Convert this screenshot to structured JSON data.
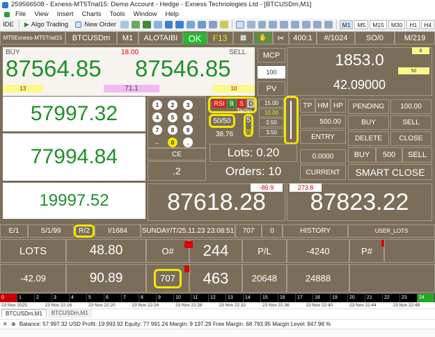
{
  "window": {
    "title": "259566508 - Exness-MT5Trial15: Demo Account - Hedge - Exness Technologies Ltd - [BTCUSDm,M1]"
  },
  "menu": [
    "File",
    "View",
    "Insert",
    "Charts",
    "Tools",
    "Window",
    "Help"
  ],
  "toolbar": {
    "ide": "IDE",
    "algo": "Algo Trading",
    "new_order": "New Order",
    "timeframes": [
      "M1",
      "M5",
      "M15",
      "M30",
      "H1",
      "H4"
    ]
  },
  "panel": {
    "top": {
      "server": "MT5Exness-MT5Trial15",
      "symbol": "BTCUSDm",
      "tf": "M1",
      "user": "ALOTAIBI",
      "ok": "OK",
      "f13": "F13",
      "leverage": "400:1",
      "count": "#/1024",
      "so": "SO/0",
      "m": "M/219"
    },
    "price": {
      "buy_label": "BUY",
      "sell_label": "SELL",
      "spread_top": "18.00",
      "bid": "87564.85",
      "ask": "87546.85",
      "lv": "13",
      "pct": "71.1",
      "rv": "10"
    },
    "mcp": {
      "label": "MCP",
      "value": "1853.0",
      "box_val": "100",
      "tag8": "8",
      "tag50": "50",
      "pv": "PV",
      "pv_value": "42.09000"
    },
    "balances": [
      "57997.32",
      "77994.84",
      "19997.52"
    ],
    "keypad": {
      "keys": [
        "1",
        "2",
        "3",
        "4",
        "5",
        "6",
        "7",
        "8",
        "9",
        "←",
        "0",
        "."
      ],
      "ce": "CE",
      "val": ".2"
    },
    "rsi": {
      "rsi": "RSI",
      "b": "B",
      "s": "S",
      "d": "D",
      "techn": "Techn",
      "fifty": "50/50",
      "five": "5",
      "v": "38.76",
      "twentyfive": "25"
    },
    "levels": [
      "15.00",
      "10.00",
      "2.50",
      "3.50"
    ],
    "tp": {
      "tp": "TP",
      "hm": "HM",
      "hp": "HP",
      "amount": "500.00",
      "entry": "ENTRY",
      "zero": "0.0000",
      "current": "CURRENT"
    },
    "lots": {
      "label": "Lots: 0.20",
      "orders": "Orders: 10"
    },
    "right": {
      "pending": "PENDING",
      "pending_val": "100.00",
      "buy": "BUY",
      "sell": "SELL",
      "delete": "DELETE",
      "close": "CLOSE",
      "buy2": "BUY",
      "v500": "500",
      "sell2": "SELL",
      "smart": "SMART CLOSE"
    },
    "big": {
      "left": "87618.28",
      "right": "87823.22",
      "neg": "-86.9",
      "pos": "273.8"
    },
    "info": {
      "e": "E/1",
      "s": "S/1/99",
      "r": "R/2",
      "i": "I/1684",
      "date": "SUNDAY/T/25.11.23 23:08:51",
      "n707": "707",
      "zero": "0",
      "history": "HISTORY",
      "user_lots": "USER_LOTS"
    },
    "row1": {
      "lots": "LOTS",
      "lots_val": "48.80",
      "o": "O#",
      "o_val": "244",
      "pl": "P/L",
      "pl_val": "-4240",
      "p": "P#"
    },
    "row2": {
      "a": "-42.09",
      "b": "90.89",
      "c": "707",
      "d": "463",
      "e": "20648",
      "f": "24888"
    }
  },
  "ruler": [
    "0",
    "1",
    "2",
    "3",
    "4",
    "5",
    "6",
    "7",
    "8",
    "9",
    "10",
    "11",
    "12",
    "13",
    "14",
    "15",
    "16",
    "17",
    "18",
    "19",
    "20",
    "21",
    "22",
    "23",
    "24"
  ],
  "time_axis": [
    "23 Nov 2025",
    "23 Nov 22:16",
    "23 Nov 22:20",
    "23 Nov 22:24",
    "23 Nov 22:28",
    "23 Nov 22:32",
    "23 Nov 22:36",
    "23 Nov 22:40",
    "23 Nov 22:44",
    "23 Nov 22:48"
  ],
  "tabs": [
    "BTCUSDm,M1",
    "BTCUSDm,M1"
  ],
  "status": "Balance: 57 997.32 USD  Profit: 19 993.92  Equity: 77 991.24  Margin: 9 197.29  Free Margin: 68 793.95  Margin Level: 847.98 %",
  "colors": {
    "panel": "#7a6e5a",
    "green": "#1e8f2a",
    "yellow": "#f5e600",
    "red": "#e00000"
  }
}
